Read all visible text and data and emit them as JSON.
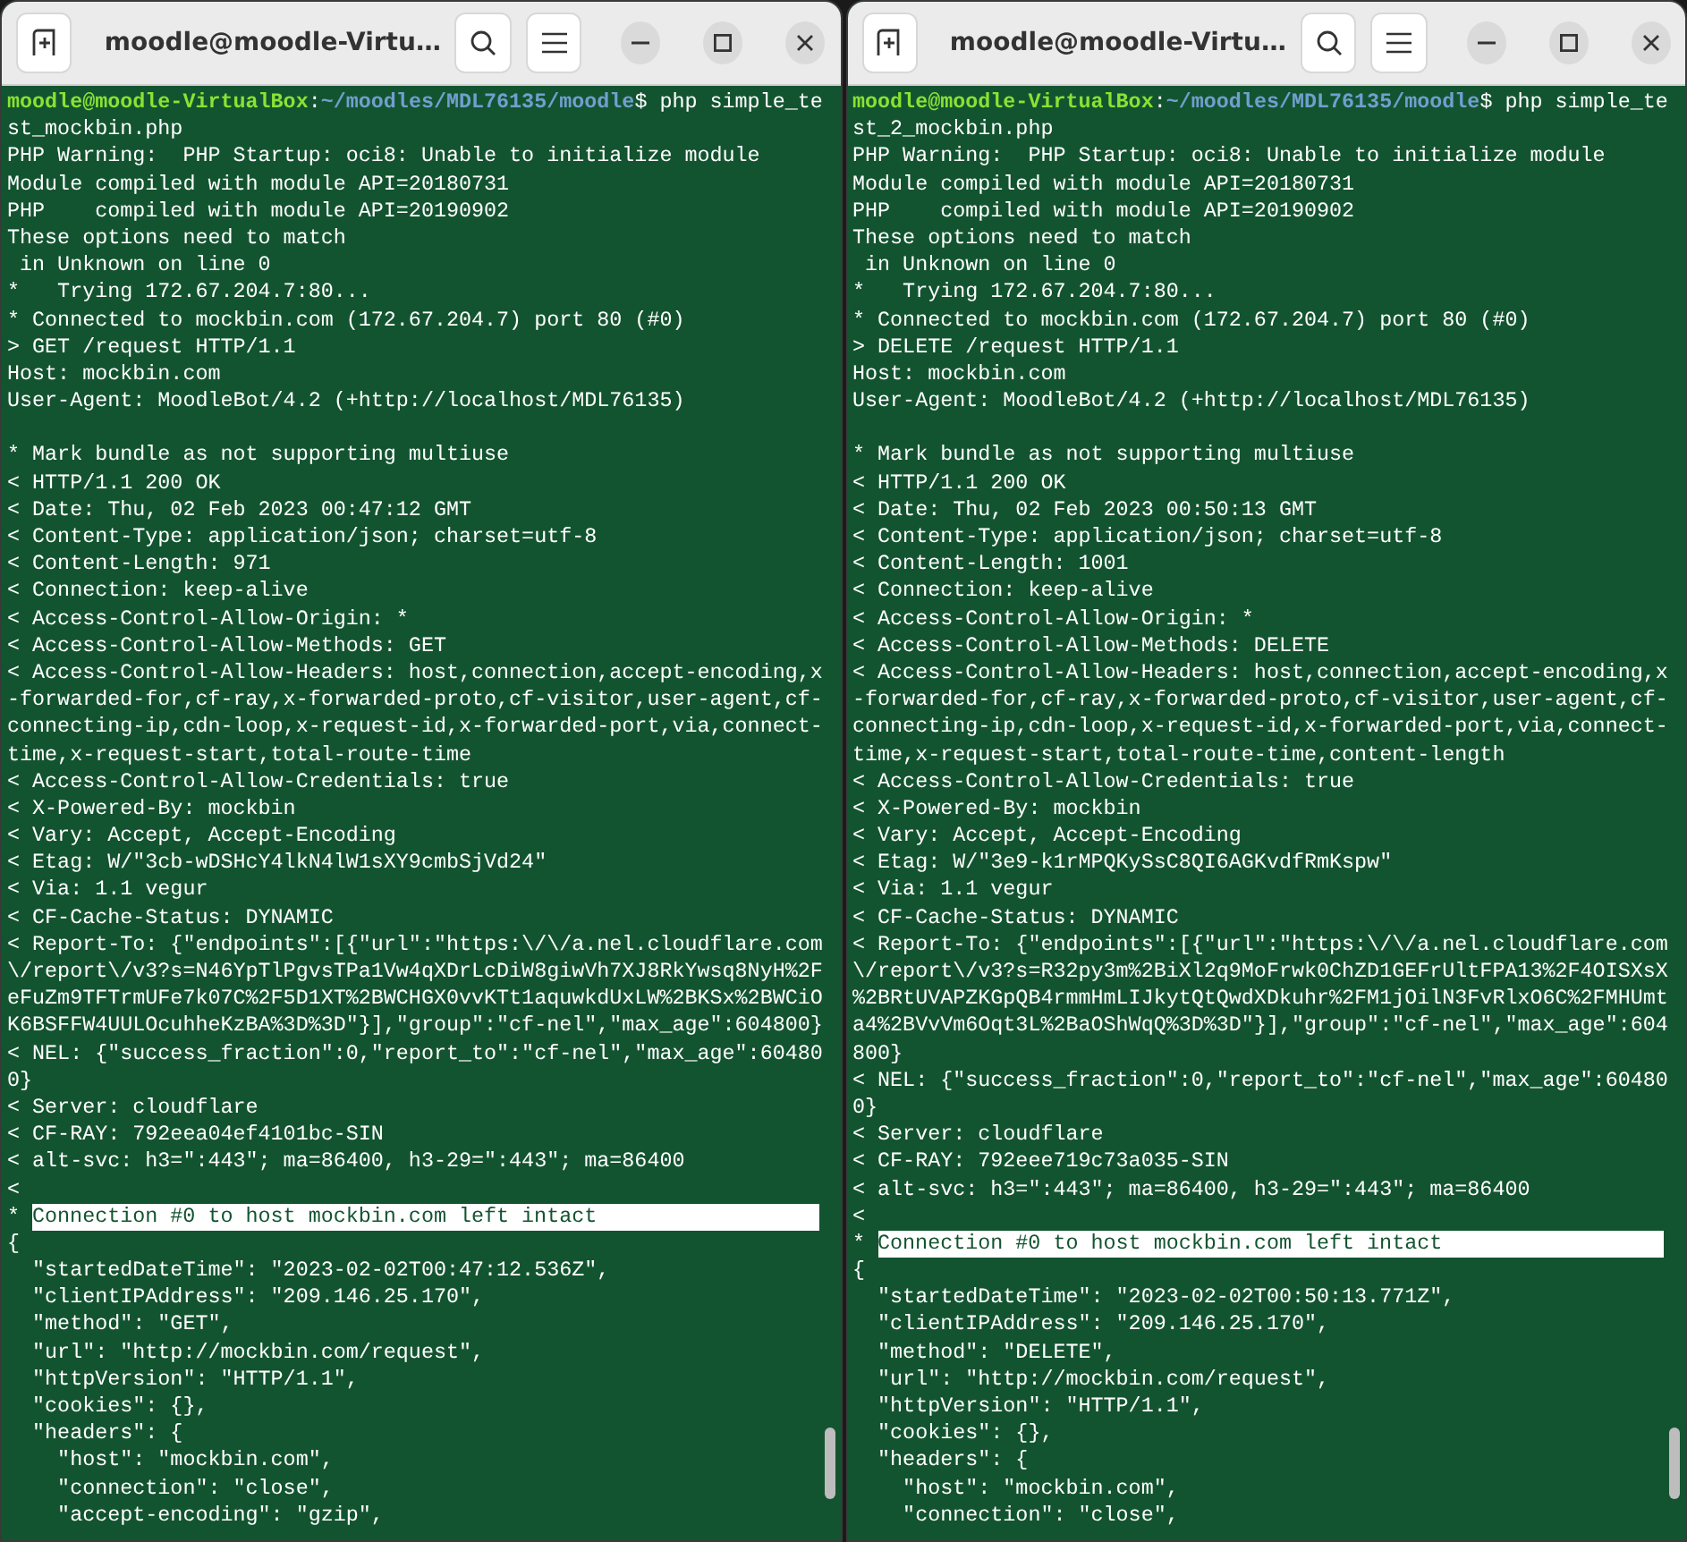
{
  "windows": [
    {
      "title": "moodle@moodle-Virtu…",
      "lines": [
        {
          "kind": "prompt",
          "user": "moodle@moodle-VirtualBox",
          "sep": ":",
          "path": "~/moodles/MDL76135/moodle",
          "command": "$ php simple_te"
        },
        {
          "kind": "text",
          "text": "st_mockbin.php"
        },
        {
          "kind": "text",
          "text": "PHP Warning:  PHP Startup: oci8: Unable to initialize module"
        },
        {
          "kind": "text",
          "text": "Module compiled with module API=20180731"
        },
        {
          "kind": "text",
          "text": "PHP    compiled with module API=20190902"
        },
        {
          "kind": "text",
          "text": "These options need to match"
        },
        {
          "kind": "text",
          "text": " in Unknown on line 0"
        },
        {
          "kind": "text",
          "text": "*   Trying 172.67.204.7:80..."
        },
        {
          "kind": "text",
          "text": "* Connected to mockbin.com (172.67.204.7) port 80 (#0)"
        },
        {
          "kind": "text",
          "text": "> GET /request HTTP/1.1"
        },
        {
          "kind": "text",
          "text": "Host: mockbin.com"
        },
        {
          "kind": "text",
          "text": "User-Agent: MoodleBot/4.2 (+http://localhost/MDL76135)"
        },
        {
          "kind": "blank"
        },
        {
          "kind": "text",
          "text": "* Mark bundle as not supporting multiuse"
        },
        {
          "kind": "text",
          "text": "< HTTP/1.1 200 OK"
        },
        {
          "kind": "text",
          "text": "< Date: Thu, 02 Feb 2023 00:47:12 GMT"
        },
        {
          "kind": "text",
          "text": "< Content-Type: application/json; charset=utf-8"
        },
        {
          "kind": "text",
          "text": "< Content-Length: 971"
        },
        {
          "kind": "text",
          "text": "< Connection: keep-alive"
        },
        {
          "kind": "text",
          "text": "< Access-Control-Allow-Origin: *"
        },
        {
          "kind": "text",
          "text": "< Access-Control-Allow-Methods: GET"
        },
        {
          "kind": "text",
          "text": "< Access-Control-Allow-Headers: host,connection,accept-encoding,x"
        },
        {
          "kind": "text",
          "text": "-forwarded-for,cf-ray,x-forwarded-proto,cf-visitor,user-agent,cf-"
        },
        {
          "kind": "text",
          "text": "connecting-ip,cdn-loop,x-request-id,x-forwarded-port,via,connect-"
        },
        {
          "kind": "text",
          "text": "time,x-request-start,total-route-time"
        },
        {
          "kind": "text",
          "text": "< Access-Control-Allow-Credentials: true"
        },
        {
          "kind": "text",
          "text": "< X-Powered-By: mockbin"
        },
        {
          "kind": "text",
          "text": "< Vary: Accept, Accept-Encoding"
        },
        {
          "kind": "text",
          "text": "< Etag: W/\"3cb-wDSHcY4lkN4lW1sXY9cmbSjVd24\""
        },
        {
          "kind": "text",
          "text": "< Via: 1.1 vegur"
        },
        {
          "kind": "text",
          "text": "< CF-Cache-Status: DYNAMIC"
        },
        {
          "kind": "text",
          "text": "< Report-To: {\"endpoints\":[{\"url\":\"https:\\/\\/a.nel.cloudflare.com"
        },
        {
          "kind": "text",
          "text": "\\/report\\/v3?s=N46YpTlPgvsTPa1Vw4qXDrLcDiW8giwVh7XJ8RkYwsq8NyH%2F"
        },
        {
          "kind": "text",
          "text": "eFuZm9TFTrmUFe7k07C%2F5D1XT%2BWCHGX0vvKTt1aquwkdUxLW%2BKSx%2BWCiO"
        },
        {
          "kind": "text",
          "text": "K6BSFFW4UULOcuhheKzBA%3D%3D\"}],\"group\":\"cf-nel\",\"max_age\":604800}"
        },
        {
          "kind": "text",
          "text": "< NEL: {\"success_fraction\":0,\"report_to\":\"cf-nel\",\"max_age\":60480"
        },
        {
          "kind": "text",
          "text": "0}"
        },
        {
          "kind": "text",
          "text": "< Server: cloudflare"
        },
        {
          "kind": "text",
          "text": "< CF-RAY: 792eea04ef4101bc-SIN"
        },
        {
          "kind": "text",
          "text": "< alt-svc: h3=\":443\"; ma=86400, h3-29=\":443\"; ma=86400"
        },
        {
          "kind": "text",
          "text": "<"
        },
        {
          "kind": "marked",
          "prefix": "*",
          "text": "Connection #0 to host mockbin.com left intact"
        },
        {
          "kind": "text",
          "text": "{"
        },
        {
          "kind": "text",
          "text": "  \"startedDateTime\": \"2023-02-02T00:47:12.536Z\","
        },
        {
          "kind": "text",
          "text": "  \"clientIPAddress\": \"209.146.25.170\","
        },
        {
          "kind": "text",
          "text": "  \"method\": \"GET\","
        },
        {
          "kind": "text",
          "text": "  \"url\": \"http://mockbin.com/request\","
        },
        {
          "kind": "text",
          "text": "  \"httpVersion\": \"HTTP/1.1\","
        },
        {
          "kind": "text",
          "text": "  \"cookies\": {},"
        },
        {
          "kind": "text",
          "text": "  \"headers\": {"
        },
        {
          "kind": "text",
          "text": "    \"host\": \"mockbin.com\","
        },
        {
          "kind": "text",
          "text": "    \"connection\": \"close\","
        },
        {
          "kind": "text",
          "text": "    \"accept-encoding\": \"gzip\","
        }
      ]
    },
    {
      "title": "moodle@moodle-Virtu…",
      "lines": [
        {
          "kind": "prompt",
          "user": "moodle@moodle-VirtualBox",
          "sep": ":",
          "path": "~/moodles/MDL76135/moodle",
          "command": "$ php simple_te"
        },
        {
          "kind": "text",
          "text": "st_2_mockbin.php"
        },
        {
          "kind": "text",
          "text": "PHP Warning:  PHP Startup: oci8: Unable to initialize module"
        },
        {
          "kind": "text",
          "text": "Module compiled with module API=20180731"
        },
        {
          "kind": "text",
          "text": "PHP    compiled with module API=20190902"
        },
        {
          "kind": "text",
          "text": "These options need to match"
        },
        {
          "kind": "text",
          "text": " in Unknown on line 0"
        },
        {
          "kind": "text",
          "text": "*   Trying 172.67.204.7:80..."
        },
        {
          "kind": "text",
          "text": "* Connected to mockbin.com (172.67.204.7) port 80 (#0)"
        },
        {
          "kind": "text",
          "text": "> DELETE /request HTTP/1.1"
        },
        {
          "kind": "text",
          "text": "Host: mockbin.com"
        },
        {
          "kind": "text",
          "text": "User-Agent: MoodleBot/4.2 (+http://localhost/MDL76135)"
        },
        {
          "kind": "blank"
        },
        {
          "kind": "text",
          "text": "* Mark bundle as not supporting multiuse"
        },
        {
          "kind": "text",
          "text": "< HTTP/1.1 200 OK"
        },
        {
          "kind": "text",
          "text": "< Date: Thu, 02 Feb 2023 00:50:13 GMT"
        },
        {
          "kind": "text",
          "text": "< Content-Type: application/json; charset=utf-8"
        },
        {
          "kind": "text",
          "text": "< Content-Length: 1001"
        },
        {
          "kind": "text",
          "text": "< Connection: keep-alive"
        },
        {
          "kind": "text",
          "text": "< Access-Control-Allow-Origin: *"
        },
        {
          "kind": "text",
          "text": "< Access-Control-Allow-Methods: DELETE"
        },
        {
          "kind": "text",
          "text": "< Access-Control-Allow-Headers: host,connection,accept-encoding,x"
        },
        {
          "kind": "text",
          "text": "-forwarded-for,cf-ray,x-forwarded-proto,cf-visitor,user-agent,cf-"
        },
        {
          "kind": "text",
          "text": "connecting-ip,cdn-loop,x-request-id,x-forwarded-port,via,connect-"
        },
        {
          "kind": "text",
          "text": "time,x-request-start,total-route-time,content-length"
        },
        {
          "kind": "text",
          "text": "< Access-Control-Allow-Credentials: true"
        },
        {
          "kind": "text",
          "text": "< X-Powered-By: mockbin"
        },
        {
          "kind": "text",
          "text": "< Vary: Accept, Accept-Encoding"
        },
        {
          "kind": "text",
          "text": "< Etag: W/\"3e9-k1rMPQKySsC8QI6AGKvdfRmKspw\""
        },
        {
          "kind": "text",
          "text": "< Via: 1.1 vegur"
        },
        {
          "kind": "text",
          "text": "< CF-Cache-Status: DYNAMIC"
        },
        {
          "kind": "text",
          "text": "< Report-To: {\"endpoints\":[{\"url\":\"https:\\/\\/a.nel.cloudflare.com"
        },
        {
          "kind": "text",
          "text": "\\/report\\/v3?s=R32py3m%2BiXl2q9MoFrwk0ChZD1GEFrUltFPA13%2F4OISXsX"
        },
        {
          "kind": "text",
          "text": "%2BRtUVAPZKGpQB4rmmHmLIJkytQtQwdXDkuhr%2FM1jOilN3FvRlxO6C%2FMHUmt"
        },
        {
          "kind": "text",
          "text": "a4%2BVvVm6Oqt3L%2BaOShWqQ%3D%3D\"}],\"group\":\"cf-nel\",\"max_age\":604"
        },
        {
          "kind": "text",
          "text": "800}"
        },
        {
          "kind": "text",
          "text": "< NEL: {\"success_fraction\":0,\"report_to\":\"cf-nel\",\"max_age\":60480"
        },
        {
          "kind": "text",
          "text": "0}"
        },
        {
          "kind": "text",
          "text": "< Server: cloudflare"
        },
        {
          "kind": "text",
          "text": "< CF-RAY: 792eee719c73a035-SIN"
        },
        {
          "kind": "text",
          "text": "< alt-svc: h3=\":443\"; ma=86400, h3-29=\":443\"; ma=86400"
        },
        {
          "kind": "text",
          "text": "<"
        },
        {
          "kind": "marked",
          "prefix": "*",
          "text": "Connection #0 to host mockbin.com left intact"
        },
        {
          "kind": "text",
          "text": "{"
        },
        {
          "kind": "text",
          "text": "  \"startedDateTime\": \"2023-02-02T00:50:13.771Z\","
        },
        {
          "kind": "text",
          "text": "  \"clientIPAddress\": \"209.146.25.170\","
        },
        {
          "kind": "text",
          "text": "  \"method\": \"DELETE\","
        },
        {
          "kind": "text",
          "text": "  \"url\": \"http://mockbin.com/request\","
        },
        {
          "kind": "text",
          "text": "  \"httpVersion\": \"HTTP/1.1\","
        },
        {
          "kind": "text",
          "text": "  \"cookies\": {},"
        },
        {
          "kind": "text",
          "text": "  \"headers\": {"
        },
        {
          "kind": "text",
          "text": "    \"host\": \"mockbin.com\","
        },
        {
          "kind": "text",
          "text": "    \"connection\": \"close\","
        }
      ]
    }
  ]
}
